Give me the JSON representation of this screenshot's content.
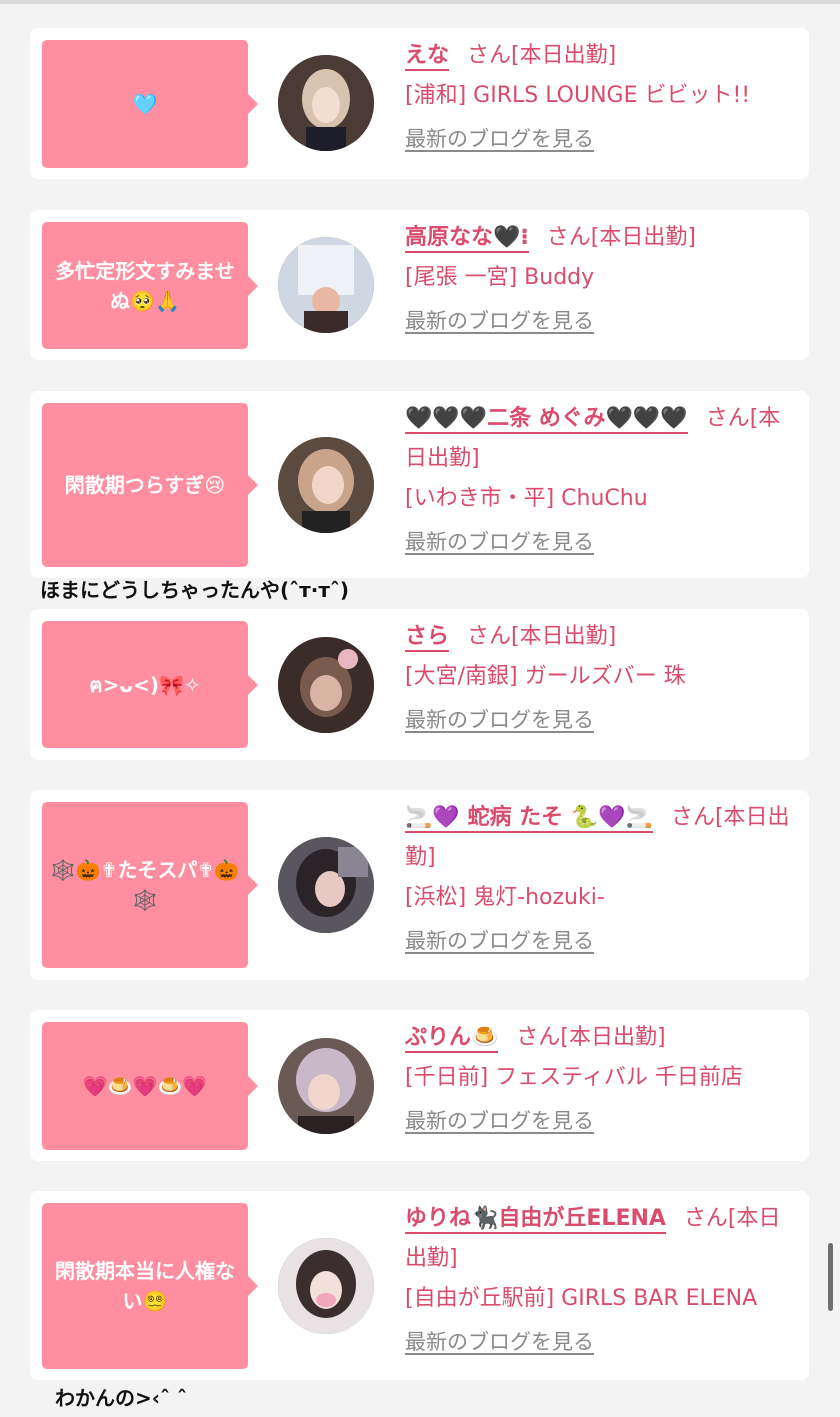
{
  "blog_link_label": "最新のブログを見る",
  "colors": {
    "accent": "#d94c6b",
    "bubble": "#ff8fa0",
    "background": "#f3f3f3"
  },
  "cards": [
    {
      "message": "🩵",
      "name": "えな",
      "suffix": "さん[本日出勤]",
      "shop": "[浦和] GIRLS LOUNGE ビビット!!"
    },
    {
      "message": "多忙定形文すみませぬ🥺🙏",
      "name": "高原なな🖤⁝",
      "suffix": "さん[本日出勤]",
      "shop": "[尾張 一宮] Buddy"
    },
    {
      "message": "閑散期つらすぎ😢",
      "name": "🖤🖤🖤二条 めぐみ🖤🖤🖤",
      "suffix": "さん[本日出勤]",
      "shop": "[いわき市・平] ChuChu"
    },
    {
      "message": "ฅ>ᴗ<)🎀✧",
      "name": "さら",
      "suffix": "さん[本日出勤]",
      "shop": "[大宮/南銀] ガールズバー 珠"
    },
    {
      "message": "🕸️🎃✟たそスパ✟🎃🕸️",
      "name": "🚬💜 蛇病 たそ 🐍💜🚬",
      "suffix": "さん[本日出勤]",
      "shop": "[浜松] 鬼灯-hozuki-"
    },
    {
      "message": "💗🍮💗🍮💗",
      "name": "ぷりん🍮",
      "suffix": "さん[本日出勤]",
      "shop": "[千日前] フェスティバル 千日前店"
    },
    {
      "message": "閑散期本当に人権ない😵‍💫",
      "name": "ゆりね🐈‍⬛自由が丘ELENA",
      "suffix": "さん[本日出勤]",
      "shop": "[自由が丘駅前] GIRLS BAR ELENA"
    }
  ],
  "captions": [
    "ほまにどうしちゃったんや(ˆᴛ·ᴛˆ)",
    "わかんの>‹ˆ ˆ"
  ]
}
